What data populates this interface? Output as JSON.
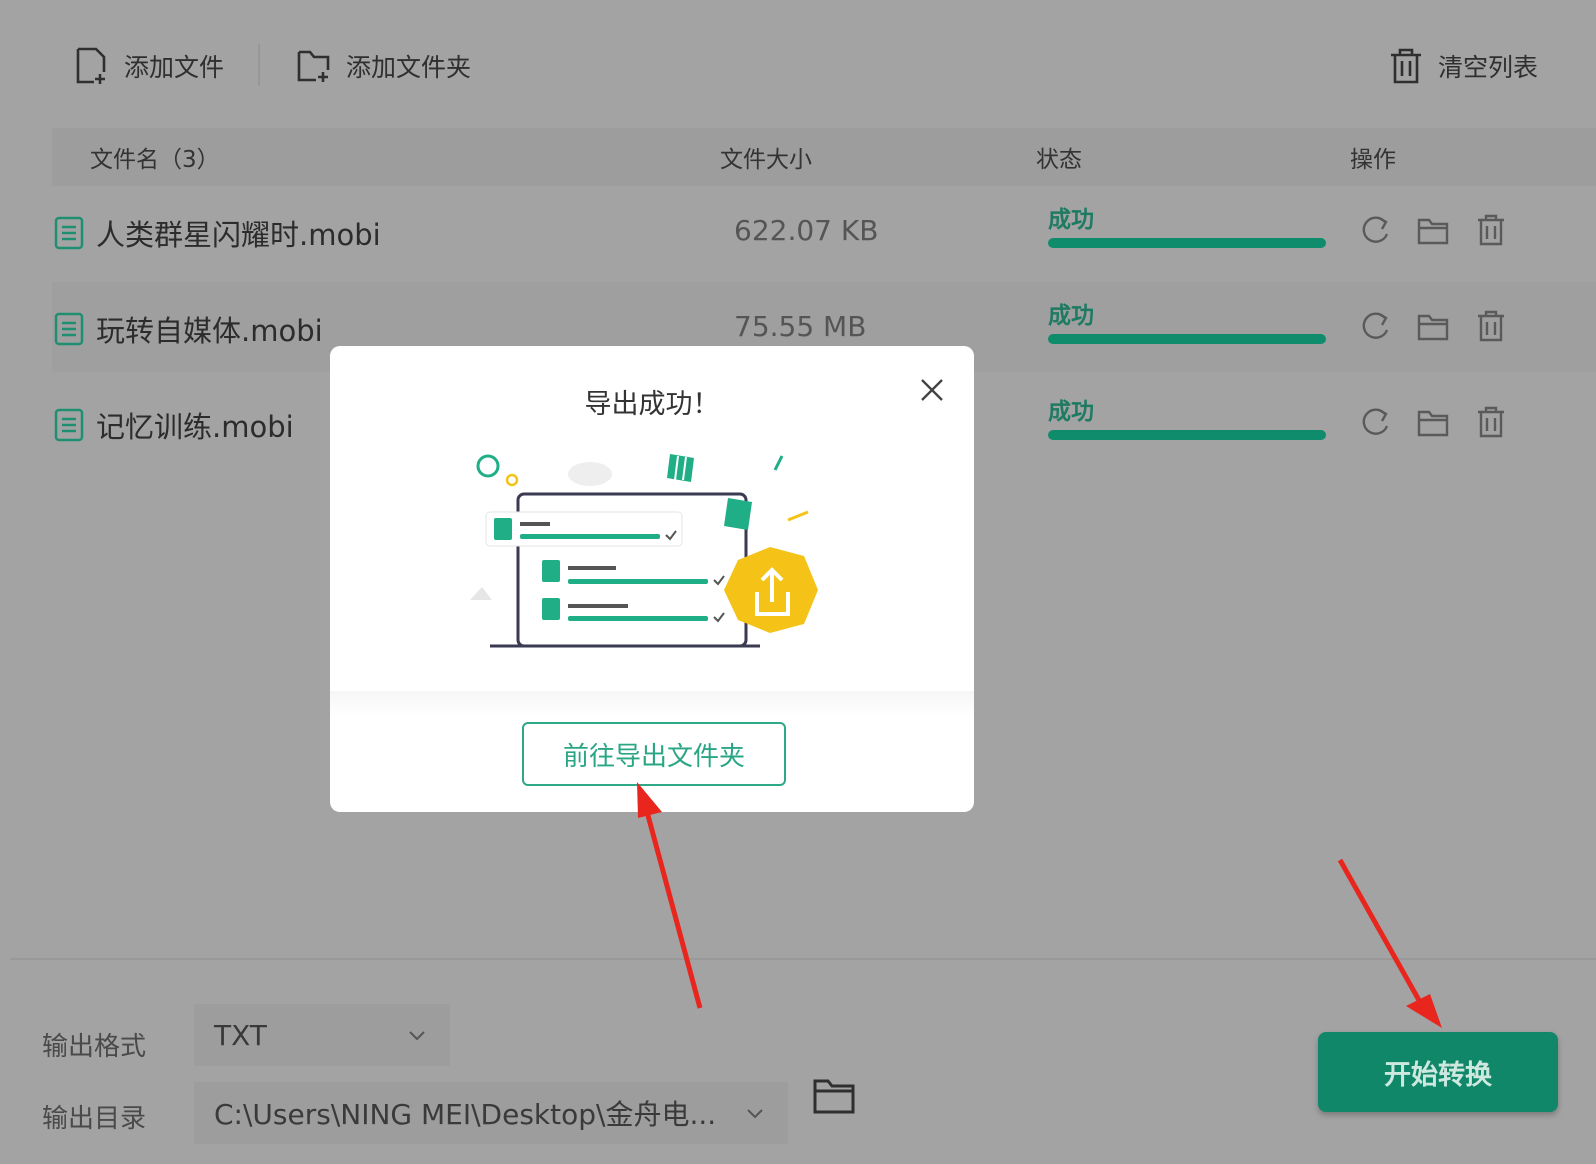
{
  "toolbar": {
    "add_file_label": "添加文件",
    "add_folder_label": "添加文件夹",
    "clear_list_label": "清空列表"
  },
  "list": {
    "headers": {
      "name": "文件名（3）",
      "size": "文件大小",
      "status": "状态",
      "actions": "操作"
    },
    "files": [
      {
        "name": "人类群星闪耀时.mobi",
        "size": "622.07 KB",
        "status": "成功",
        "progress": 100
      },
      {
        "name": "玩转自媒体.mobi",
        "size": "75.55 MB",
        "status": "成功",
        "progress": 100
      },
      {
        "name": "记忆训练.mobi",
        "size": "",
        "status": "成功",
        "progress": 100
      }
    ],
    "row_action_icons": [
      "refresh-icon",
      "folder-icon",
      "trash-icon"
    ]
  },
  "settings": {
    "format_label": "输出格式",
    "format_value": "TXT",
    "dir_label": "输出目录",
    "dir_value": "C:\\Users\\NING MEI\\Desktop\\金舟电..."
  },
  "start_button_label": "开始转换",
  "dialog": {
    "title": "导出成功！",
    "goto_folder_label": "前往导出文件夹"
  },
  "colors": {
    "accent": "#11876a",
    "status_green": "#0f8c6c",
    "overlay_bg": "#a3a3a3",
    "arrow_red": "#e8261e",
    "illustration_yellow": "#f5c318"
  }
}
